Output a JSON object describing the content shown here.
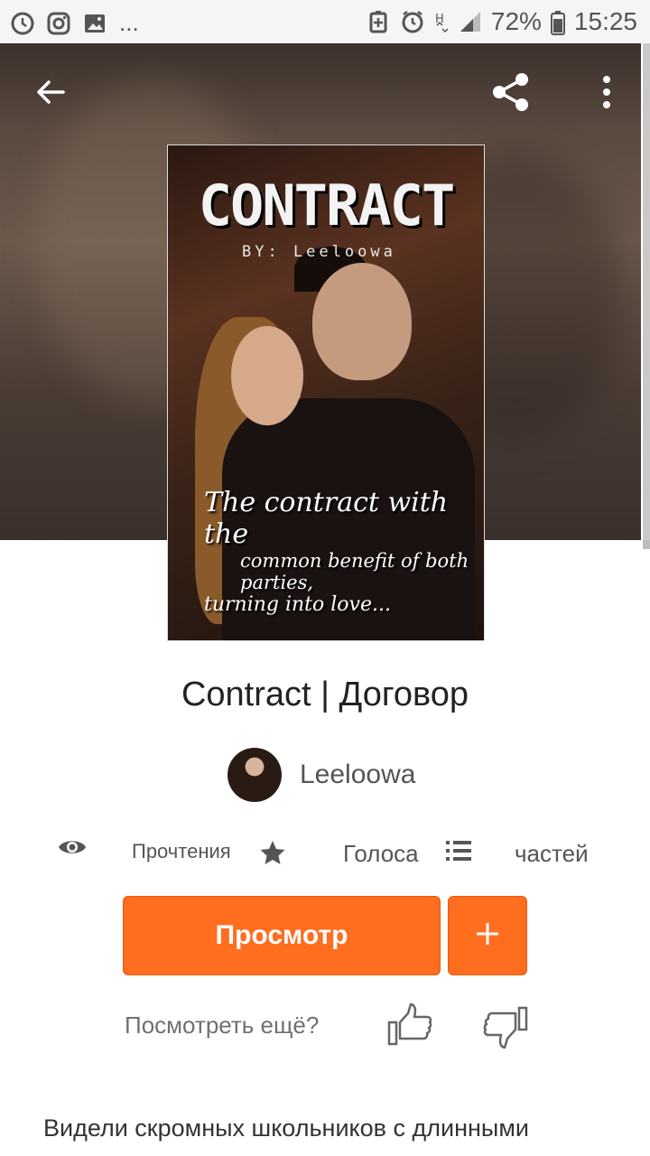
{
  "status_bar": {
    "left_icons": [
      "clock-sync-icon",
      "instagram-icon",
      "image-icon"
    ],
    "ellipsis": "...",
    "battery": "72%",
    "time": "15:25"
  },
  "header": {
    "back_icon": "arrow-left-icon",
    "share_icon": "share-icon",
    "more_icon": "more-vertical-icon"
  },
  "cover": {
    "title": "CONTRACT",
    "byline": "BY: Leeloowa",
    "tagline": [
      "The contract with the",
      "common benefit of both parties,",
      "turning into love..."
    ]
  },
  "story": {
    "title": "Contract | Договор",
    "author": "Leeloowa"
  },
  "stats": {
    "reads_label": "Прочтения",
    "votes_label": "Голоса",
    "parts_label": "частей"
  },
  "actions": {
    "read_label": "Просмотр",
    "add_label": "+",
    "more_label": "Посмотреть ещё?"
  },
  "description": "Видели скромных школьников с длинными",
  "colors": {
    "accent": "#ff6d1f",
    "text_primary": "#222222",
    "text_secondary": "#555555"
  }
}
